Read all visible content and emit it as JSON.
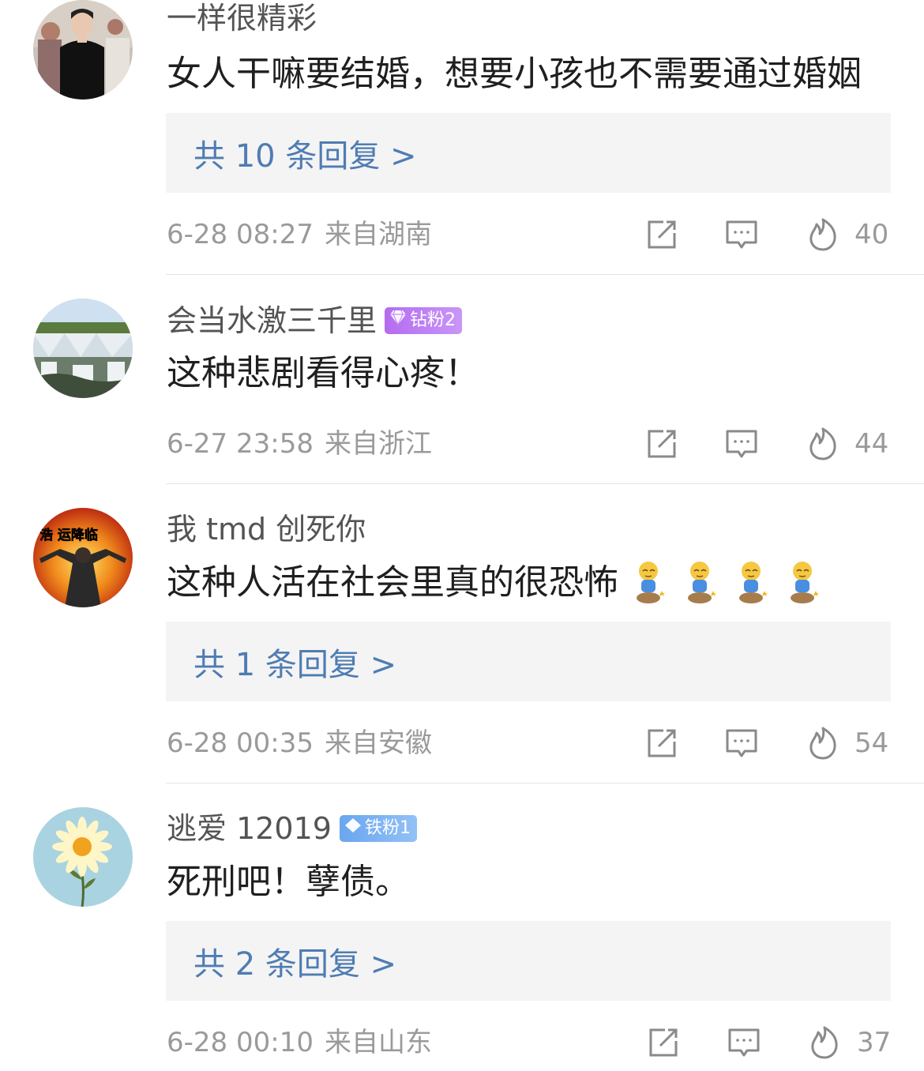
{
  "comments": [
    {
      "username": "一样很精彩",
      "text": "女人干嘛要结婚，想要小孩也不需要通过婚姻",
      "replies_label": "共 10 条回复 >",
      "date": "6-28 08:27",
      "location": "来自湖南",
      "likes": "40",
      "avatar": "person-in-black-suit"
    },
    {
      "username": "会当水激三千里",
      "badge": "钻粉2",
      "badge_icon": "diamond-icon",
      "text": "这种悲剧看得心疼！",
      "date": "6-27 23:58",
      "location": "来自浙江",
      "likes": "44",
      "avatar": "waterfall-landscape"
    },
    {
      "username": "我 tmd 创死你",
      "text": "这种人活在社会里真的很恐怖",
      "emoji": [
        "kneeling-emoji",
        "kneeling-emoji",
        "kneeling-emoji",
        "kneeling-emoji"
      ],
      "replies_label": "共 1 条回复 >",
      "date": "6-28 00:35",
      "location": "来自安徽",
      "likes": "54",
      "avatar": "浩 运降临"
    },
    {
      "username": "逃爱 12019",
      "badge": "铁粉1",
      "badge_icon": "diamond-icon",
      "text": "死刑吧！孽债。",
      "replies_label": "共 2 条回复 >",
      "date": "6-28 00:10",
      "location": "来自山东",
      "likes": "37",
      "avatar": "daisy-flower"
    }
  ],
  "icons": {
    "share": "share-icon",
    "comment": "comment-icon",
    "like": "fire-icon"
  },
  "colors": {
    "reply_link": "#4f7cb3",
    "meta": "#9a9a9a",
    "reply_bg": "#f4f4f4",
    "diamond_badge": "#b46cf0",
    "iron_badge": "#6aa6ef"
  }
}
